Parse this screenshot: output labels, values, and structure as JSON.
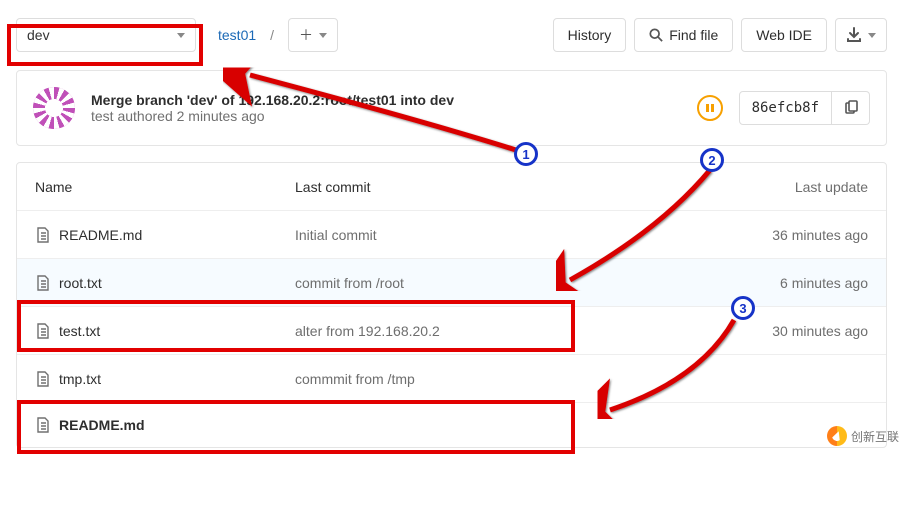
{
  "branch": {
    "name": "dev"
  },
  "breadcrumb": {
    "repo": "test01",
    "sep": "/"
  },
  "toolbar": {
    "history": "History",
    "find_file": "Find file",
    "web_ide": "Web IDE"
  },
  "commit": {
    "title": "Merge branch 'dev' of 192.168.20.2:root/test01 into dev",
    "author_line": "test authored 2 minutes ago",
    "ci_status": "paused",
    "sha_short": "86efcb8f"
  },
  "file_table": {
    "headers": {
      "name": "Name",
      "commit": "Last commit",
      "update": "Last update"
    },
    "rows": [
      {
        "name": "README.md",
        "commit": "Initial commit",
        "update": "36 minutes ago",
        "hl": false
      },
      {
        "name": "root.txt",
        "commit": "commit from /root",
        "update": "6 minutes ago",
        "hl": true
      },
      {
        "name": "test.txt",
        "commit": "alter from 192.168.20.2",
        "update": "30 minutes ago",
        "hl": false
      },
      {
        "name": "tmp.txt",
        "commit": "commmit from /tmp",
        "update": "",
        "hl": false
      }
    ]
  },
  "readme": {
    "title": "README.md"
  },
  "watermark": {
    "text": "创新互联"
  },
  "annotations": {
    "badges": [
      "1",
      "2",
      "3"
    ],
    "red_boxes": "branch-switcher, row-root, row-tmp highlighted"
  }
}
